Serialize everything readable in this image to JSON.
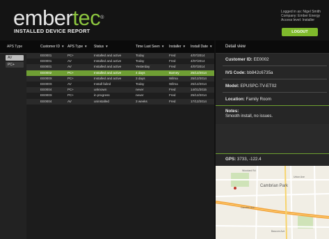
{
  "header": {
    "brand_part1": "ember",
    "brand_part2": "tec",
    "brand_mark": "®",
    "subtitle": "INSTALLED DEVICE REPORT",
    "user_line1": "Logged in as: Nigel Smith",
    "user_line2": "Company: Ember Energy",
    "user_line3": "Access level: Installer",
    "logout_label": "LOGOUT"
  },
  "sidebar": {
    "header": "APS Type",
    "items": [
      {
        "label": "AV",
        "active": true
      },
      {
        "label": "PC+",
        "active": false
      }
    ]
  },
  "table": {
    "columns": [
      "Customer ID",
      "APS Type",
      "Status",
      "Time Last Seen",
      "Installer",
      "Install Date"
    ],
    "rows": [
      [
        "EE0001",
        "PC+",
        "Installed and active",
        "Today",
        "Fred",
        "4/07/2014"
      ],
      [
        "EE0001",
        "AV",
        "Installed and active",
        "Today",
        "Fred",
        "4/07/2014"
      ],
      [
        "EE0001",
        "AV",
        "Installed and active",
        "Yesterday",
        "Fred",
        "4/07/2014"
      ],
      [
        "EE0002",
        "PC+",
        "Installed and active",
        "4 days",
        "Barney",
        "25/12/2014"
      ],
      [
        "EE000X",
        "PC+",
        "Installed and active",
        "3 days",
        "Wilma",
        "25/12/2014"
      ],
      [
        "EE000X",
        "AV",
        "Install failed",
        "Today",
        "Wilma",
        "25/12/2014"
      ],
      [
        "EE0004",
        "PC+",
        "unknown",
        "never",
        "Fred",
        "14/01/2015"
      ],
      [
        "EE000X",
        "PC+",
        "in progress",
        "never",
        "Fred",
        "25/12/2014"
      ],
      [
        "EE0004",
        "AV",
        "uninstalled",
        "3 weeks",
        "Fred",
        "17/12/2014"
      ]
    ],
    "selected_index": 3
  },
  "detail": {
    "title": "Detail view",
    "customer_label": "Customer ID:",
    "customer_value": "EE0002",
    "ivs_label": "IVS Code:",
    "ivs_value": "bb842c6735a",
    "model_label": "Model:",
    "model_value": "EPUSPC-TV-ET02",
    "location_label": "Location:",
    "location_value": "Family Room",
    "notes_label": "Notes:",
    "notes_value": "Smooth install, no issues.",
    "gps_label": "GPS:",
    "gps_value": "3733, -122.4"
  },
  "map": {
    "labels": [
      "Cambrian Park",
      "Woodard Rd",
      "Camden Ave",
      "Union Ave",
      "Bascom Ave"
    ]
  },
  "colors": {
    "accent": "#7fba2c",
    "selected_row": "#6f9f34",
    "background": "#101010"
  }
}
